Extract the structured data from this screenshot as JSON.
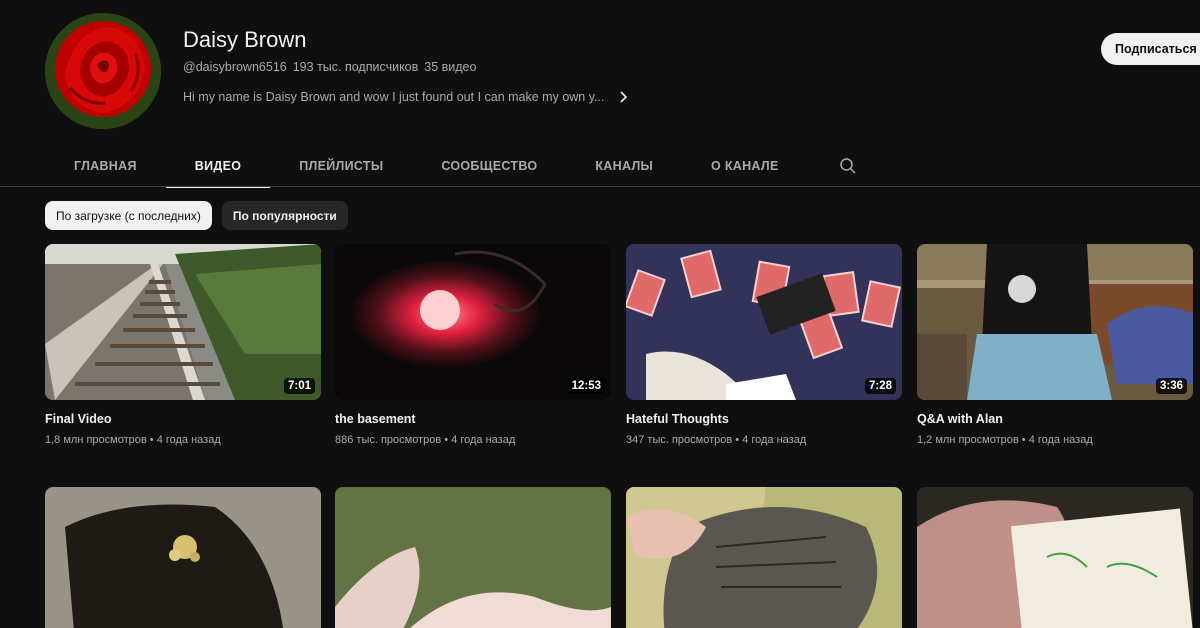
{
  "channel": {
    "name": "Daisy Brown",
    "handle": "@daisybrown6516",
    "subscribers": "193 тыс. подписчиков",
    "video_count": "35 видео",
    "description": "Hi my name is Daisy Brown and wow I just found out I can make my own y...",
    "subscribe_label": "Подписаться"
  },
  "tabs": [
    {
      "label": "ГЛАВНАЯ"
    },
    {
      "label": "ВИДЕО"
    },
    {
      "label": "ПЛЕЙЛИСТЫ"
    },
    {
      "label": "СООБЩЕСТВО"
    },
    {
      "label": "КАНАЛЫ"
    },
    {
      "label": "О КАНАЛЕ"
    }
  ],
  "active_tab": "ВИДЕО",
  "filters": [
    {
      "label": "По загрузке (с последних)"
    },
    {
      "label": "По популярности"
    }
  ],
  "videos": [
    {
      "title": "Final Video",
      "duration": "7:01",
      "views": "1,8 млн просмотров",
      "age": "4 года назад"
    },
    {
      "title": "the basement",
      "duration": "12:53",
      "views": "886 тыс. просмотров",
      "age": "4 года назад"
    },
    {
      "title": "Hateful Thoughts",
      "duration": "7:28",
      "views": "347 тыс. просмотров",
      "age": "4 года назад"
    },
    {
      "title": "Q&A with Alan",
      "duration": "3:36",
      "views": "1,2 млн просмотров",
      "age": "4 года назад"
    }
  ],
  "colors": {
    "background": "#0f0f0f",
    "text": "#f1f1f1",
    "secondary_text": "#aaaaaa",
    "chip_bg": "#272727"
  }
}
